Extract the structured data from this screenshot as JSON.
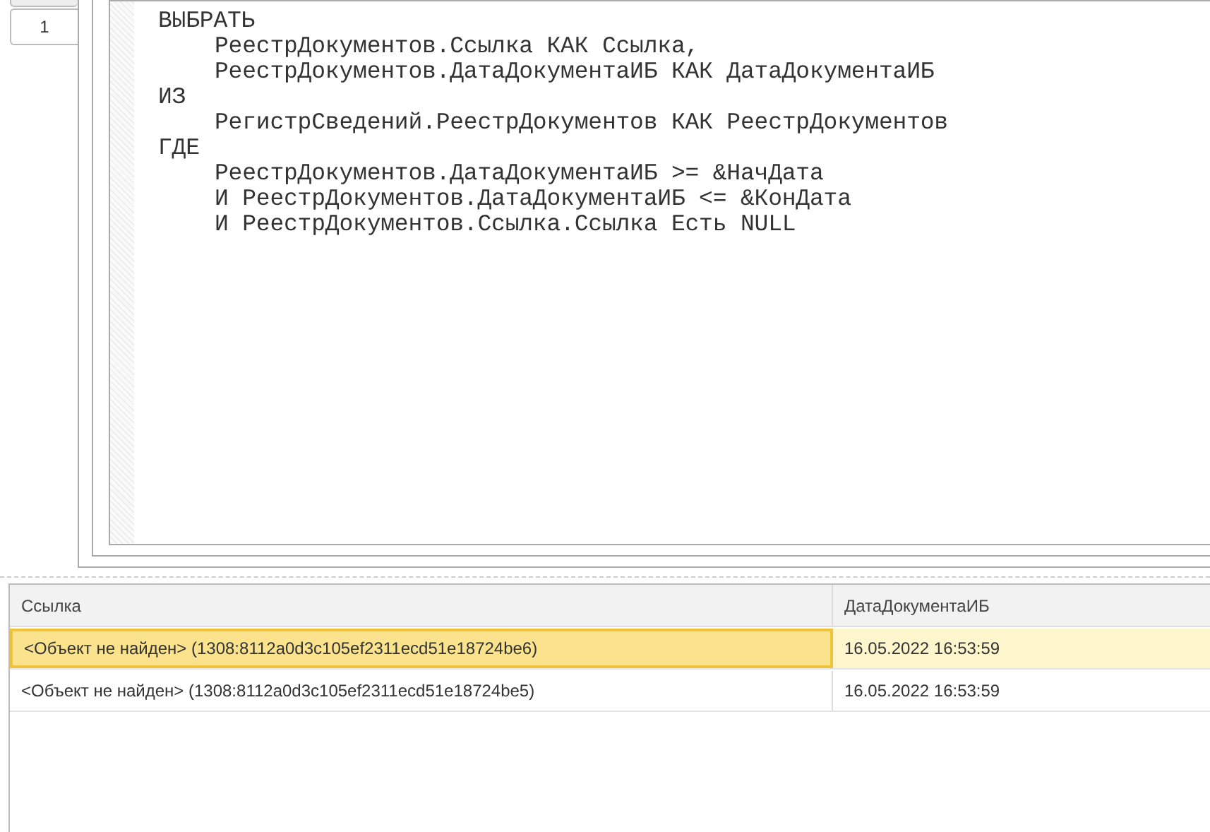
{
  "tabs": [
    {
      "selected": false
    },
    {
      "label": "1",
      "selected": true
    }
  ],
  "query_lines": [
    {
      "text": "ВЫБРАТЬ",
      "children": [
        {
          "text": "РеестрДокументов.Ссылка КАК Ссылка,"
        },
        {
          "text": "РеестрДокументов.ДатаДокументаИБ КАК ДатаДокументаИБ"
        }
      ]
    },
    {
      "text": "ИЗ",
      "children": [
        {
          "text": "РегистрСведений.РеестрДокументов КАК РеестрДокументов"
        }
      ]
    },
    {
      "text": "ГДЕ",
      "children": [
        {
          "text": "РеестрДокументов.ДатаДокументаИБ >= &НачДата"
        },
        {
          "text": "И РеестрДокументов.ДатаДокументаИБ <= &КонДата"
        },
        {
          "text": "И РеестрДокументов.Ссылка.Ссылка Есть NULL"
        }
      ]
    }
  ],
  "table": {
    "columns": [
      "Ссылка",
      "ДатаДокументаИБ"
    ],
    "rows": [
      {
        "cells": [
          "<Объект не найден> (1308:8112a0d3c105ef2311ecd51e18724be6)",
          "16.05.2022 16:53:59"
        ],
        "selected": true
      },
      {
        "cells": [
          "<Объект не найден> (1308:8112a0d3c105ef2311ecd51e18724be5)",
          "16.05.2022 16:53:59"
        ],
        "selected": false
      }
    ]
  }
}
